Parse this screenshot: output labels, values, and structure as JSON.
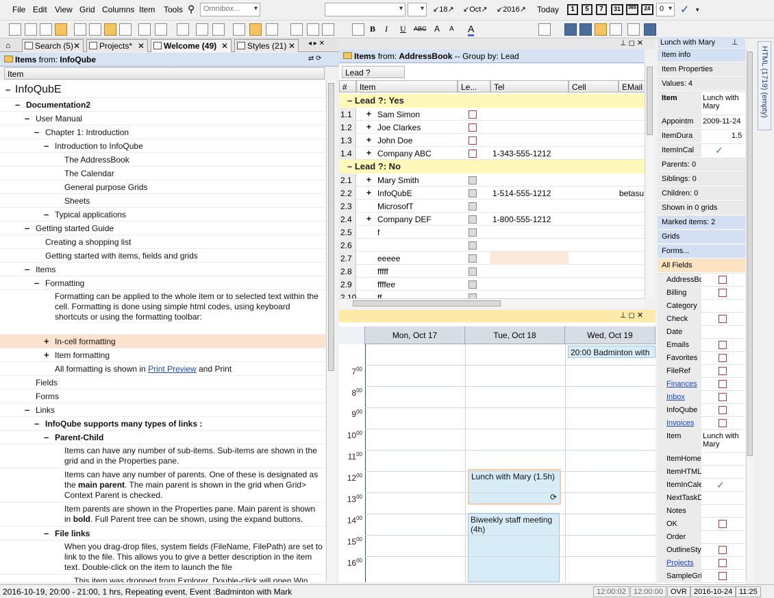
{
  "menu": [
    "File",
    "Edit",
    "View",
    "Grid",
    "Columns",
    "Item",
    "Tools"
  ],
  "omnibox_placeholder": "Omnibox...",
  "toolbar": {
    "day_value": "18",
    "month_value": "Oct",
    "year_value": "2016",
    "today_label": "Today",
    "view_buttons": [
      "1",
      "5",
      "7",
      "31",
      "365",
      "24"
    ],
    "zero_value": "0"
  },
  "tabs": [
    {
      "label": "Search (5)"
    },
    {
      "label": "Projects*"
    },
    {
      "label": "Welcome (49)"
    },
    {
      "label": "Styles (21)"
    }
  ],
  "left_pane": {
    "header_prefix": "Items",
    "header_from": "from:",
    "header_source": "InfoQube",
    "column": "Item",
    "rows": [
      {
        "text": "InfoQubE",
        "indent": 0,
        "exp": "-",
        "big": true
      },
      {
        "text": "Documentation2",
        "indent": 1,
        "exp": "-",
        "bold": true
      },
      {
        "text": "User Manual",
        "indent": 2,
        "exp": "-"
      },
      {
        "text": "Chapter 1: Introduction",
        "indent": 3,
        "exp": "-"
      },
      {
        "text": "Introduction to InfoQube",
        "indent": 4,
        "exp": "-"
      },
      {
        "text": "The AddressBook",
        "indent": 5,
        "exp": ""
      },
      {
        "text": "The Calendar",
        "indent": 5,
        "exp": ""
      },
      {
        "text": "General purpose Grids",
        "indent": 5,
        "exp": ""
      },
      {
        "text": "Sheets",
        "indent": 5,
        "exp": ""
      },
      {
        "text": "Typical applications",
        "indent": 4,
        "exp": "-"
      },
      {
        "text": "Getting started Guide",
        "indent": 2,
        "exp": "-"
      },
      {
        "text": "Creating a shopping list",
        "indent": 3,
        "exp": ""
      },
      {
        "text": "Getting started with items, fields and grids",
        "indent": 3,
        "exp": ""
      },
      {
        "text": "Items",
        "indent": 2,
        "exp": "-"
      },
      {
        "text": "Formatting",
        "indent": 3,
        "exp": "-"
      }
    ],
    "formatting_paragraph": "Formatting can be applied to the whole item or to selected text within the cell. Formatting is done using simple html codes, using keyboard shortcuts or using the formatting toolbar:",
    "rows2": [
      {
        "text": "In-cell formatting",
        "indent": 4,
        "exp": "+",
        "hl": true
      },
      {
        "text": "Item formatting",
        "indent": 4,
        "exp": "+"
      }
    ],
    "print_prefix": "All formatting is shown in ",
    "print_link": "Print Preview",
    "print_suffix": " and Print",
    "rows3": [
      {
        "text": "Fields",
        "indent": 2,
        "exp": ""
      },
      {
        "text": "Forms",
        "indent": 2,
        "exp": ""
      },
      {
        "text": "Links",
        "indent": 2,
        "exp": "-"
      },
      {
        "text": "InfoQube supports many types of links :",
        "indent": 3,
        "exp": "-",
        "bold": true
      },
      {
        "text": "Parent-Child",
        "indent": 4,
        "exp": "-",
        "bold": true
      }
    ],
    "para1": "Items can have any number of sub-items. Sub-items are shown in the grid and in the Properties pane.",
    "para2_a": "Items can have any number of parents. One of these is designated as the ",
    "para2_b": "main parent",
    "para2_c": ". The main parent is shown in the grid when Grid> Context Parent is checked.",
    "para3_a": "Item parents are shown in the Properties pane. Main parent is shown in ",
    "para3_b": "bold",
    "para3_c": ". Full Parent tree can be shown, using the expand buttons.",
    "file_links": "File links",
    "para4": "When you drag-drop files, system fields (FileName, FilePath) are set to link to the file. This allows you to give a better description in the item text. Double-click on the item to launch the file",
    "para5": "This item was dropped from Explorer. Double-click will open Win"
  },
  "grid_pane": {
    "header_prefix": "Items",
    "header_from": "from:",
    "header_source": "AddressBook",
    "header_groupby": "-- Group by:",
    "header_group_field": "Lead",
    "group_chip": "Lead ?",
    "columns": [
      "#",
      "Item",
      "Le...",
      "Tel",
      "Cell",
      "EMail"
    ],
    "group_yes": "Lead ?: Yes",
    "group_no": "Lead ?: No",
    "rows_yes": [
      {
        "num": "1.1",
        "item": "Sam Simon",
        "tel": "",
        "email": "",
        "plus": true
      },
      {
        "num": "1.2",
        "item": "Joe Clarkes",
        "tel": "",
        "email": "",
        "plus": true
      },
      {
        "num": "1.3",
        "item": "John Doe",
        "tel": "",
        "email": "",
        "plus": true
      },
      {
        "num": "1.4",
        "item": "Company ABC",
        "tel": "1-343-555-1212",
        "email": "",
        "plus": true
      }
    ],
    "rows_no": [
      {
        "num": "2.1",
        "item": "Mary Smith",
        "tel": "",
        "email": "",
        "plus": true
      },
      {
        "num": "2.2",
        "item": "InfoQubE",
        "tel": "1-514-555-1212",
        "email": "betasu",
        "plus": true
      },
      {
        "num": "2.3",
        "item": "MicrosofT",
        "tel": "",
        "email": "",
        "plus": false
      },
      {
        "num": "2.4",
        "item": "Company DEF",
        "tel": "1-800-555-1212",
        "email": "",
        "plus": true
      },
      {
        "num": "2.5",
        "item": "f",
        "tel": "",
        "email": "",
        "plus": false
      },
      {
        "num": "2.6",
        "item": "",
        "tel": "",
        "email": "",
        "plus": false
      },
      {
        "num": "2.7",
        "item": "eeeee",
        "tel": "",
        "email": "",
        "plus": false
      },
      {
        "num": "2.8",
        "item": "fffff",
        "tel": "",
        "email": "",
        "plus": false
      },
      {
        "num": "2.9",
        "item": "ffffee",
        "tel": "",
        "email": "",
        "plus": false
      },
      {
        "num": "2.10",
        "item": "ff",
        "tel": "",
        "email": "",
        "plus": false
      }
    ]
  },
  "calendar": {
    "days": [
      "Mon, Oct 17",
      "Tue, Oct 18",
      "Wed, Oct 19"
    ],
    "hours": [
      "7",
      "8",
      "9",
      "10",
      "11",
      "12",
      "13",
      "14",
      "15",
      "16"
    ],
    "minutes": "00",
    "events": [
      {
        "text": "20:00 Badminton with"
      },
      {
        "text": "Lunch with Mary (1.5h)"
      },
      {
        "text": "Biweekly staff meeting (4h)"
      }
    ]
  },
  "properties": {
    "title": "Lunch with Mary",
    "rows": [
      {
        "label": "Item info",
        "type": "blue"
      },
      {
        "label": "Item Properties",
        "type": "full"
      },
      {
        "label": "Values: 4",
        "type": "full"
      },
      {
        "label": "Item",
        "value": "Lunch with Mary",
        "type": "kv2"
      },
      {
        "label": "Appointm",
        "value": "2009-11-24",
        "type": "kv"
      },
      {
        "label": "ItemDura",
        "value": "1.5",
        "type": "kv"
      },
      {
        "label": "ItemInCal",
        "value": "✓",
        "type": "kv"
      },
      {
        "label": "Parents: 0",
        "type": "full"
      },
      {
        "label": "Siblings: 0",
        "type": "full"
      },
      {
        "label": "Children: 0",
        "type": "full"
      },
      {
        "label": "Shown in 0 grids",
        "type": "full"
      },
      {
        "label": "Marked items: 2",
        "type": "blue"
      },
      {
        "label": "Grids",
        "type": "blue"
      },
      {
        "label": "Forms...",
        "type": "blue"
      },
      {
        "label": "All Fields",
        "type": "orange"
      }
    ],
    "fields": [
      {
        "label": "AddressBo",
        "tri": true,
        "cb": true
      },
      {
        "label": "Billing",
        "tri": true,
        "cb": true
      },
      {
        "label": "Category",
        "tri": false,
        "cb": false
      },
      {
        "label": "Check",
        "tri": false,
        "cb": true
      },
      {
        "label": "Date",
        "tri": true,
        "cb": false
      },
      {
        "label": "Emails",
        "tri": true,
        "cb": true
      },
      {
        "label": "Favorites",
        "tri": false,
        "cb": true
      },
      {
        "label": "FileRef",
        "tri": true,
        "cb": true
      },
      {
        "label": "Finances",
        "tri": true,
        "cb": true,
        "link": true
      },
      {
        "label": "Inbox",
        "tri": true,
        "cb": true,
        "link": true
      },
      {
        "label": "InfoQube",
        "tri": false,
        "cb": true
      },
      {
        "label": "Invoices",
        "tri": true,
        "cb": true,
        "link": true
      },
      {
        "label": "Item",
        "tri": true,
        "cb": false,
        "value": "Lunch with Mary"
      },
      {
        "label": "ItemHomeC",
        "tri": false,
        "cb": false
      },
      {
        "label": "ItemHTMLV",
        "tri": false,
        "cb": false
      },
      {
        "label": "ItemInCale",
        "tri": false,
        "cb": false,
        "check": true
      },
      {
        "label": "NextTaskD",
        "tri": false,
        "cb": false
      },
      {
        "label": "Notes",
        "tri": false,
        "cb": false
      },
      {
        "label": "OK",
        "tri": false,
        "cb": true
      },
      {
        "label": "Order",
        "tri": false,
        "cb": false
      },
      {
        "label": "OutlineStyl",
        "tri": false,
        "cb": true
      },
      {
        "label": "Projects",
        "tri": true,
        "cb": true,
        "link": true
      },
      {
        "label": "SampleGri",
        "tri": true,
        "cb": true
      }
    ]
  },
  "side_tab": "HTML (1719) (empty)",
  "status": {
    "text": "2016-10-19, 20:00 - 21:00, 1 hrs, Repeating event, Event :Badminton with Mark",
    "t1": "12:00:02",
    "t2": "12:00:00",
    "ovr": "OVR",
    "date": "2016-10-24",
    "time": "11:25"
  }
}
